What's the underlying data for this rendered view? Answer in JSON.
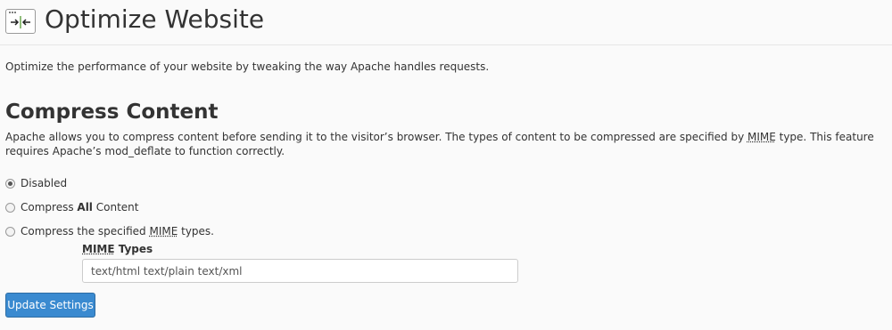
{
  "header": {
    "title": "Optimize Website",
    "icon": "compress-arrows-icon"
  },
  "intro": "Optimize the performance of your website by tweaking the way Apache handles requests.",
  "section": {
    "title": "Compress Content",
    "desc_before": "Apache allows you to compress content before sending it to the visitor’s browser. The types of content to be compressed are specified by ",
    "desc_abbr": "MIME",
    "desc_after": " type. This feature requires Apache’s mod_deflate to function correctly."
  },
  "options": {
    "disabled": {
      "label": "Disabled",
      "selected": true
    },
    "compress_all": {
      "prefix": "Compress ",
      "bold": "All",
      "suffix": " Content",
      "selected": false
    },
    "compress_specified": {
      "prefix": "Compress the specified ",
      "abbr": "MIME",
      "suffix": " types.",
      "selected": false
    }
  },
  "mime": {
    "label_abbr": "MIME",
    "label_rest": " Types",
    "value": "text/html text/plain text/xml"
  },
  "update_button": "Update Settings",
  "colors": {
    "primary_button": "#3a8ad0",
    "background": "#fafafa"
  }
}
